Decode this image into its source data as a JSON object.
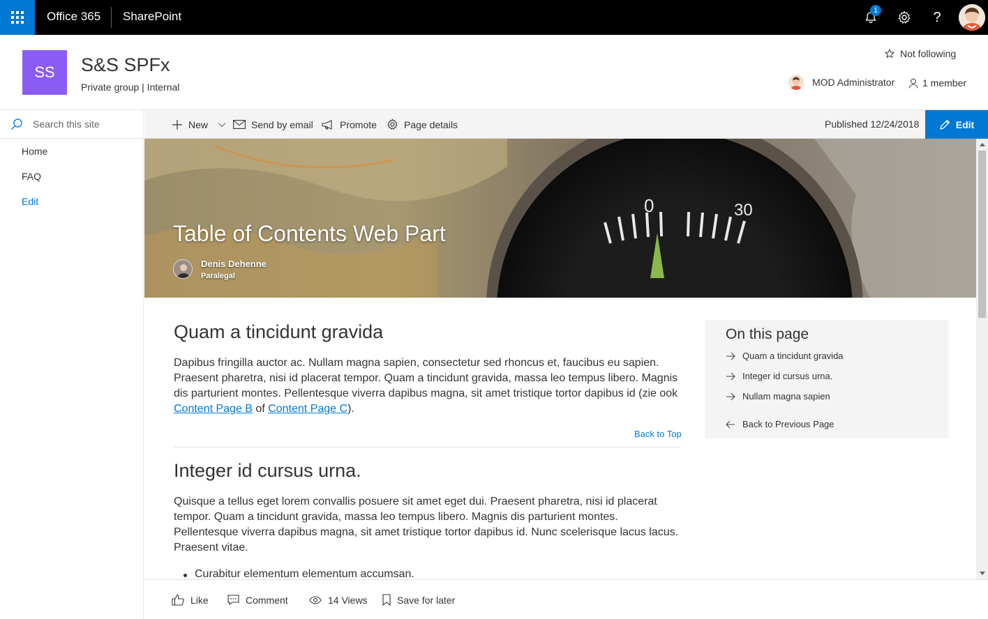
{
  "suite": {
    "app_name": "Office 365",
    "product": "SharePoint",
    "notification_count": "1",
    "help_label": "?"
  },
  "site": {
    "logo_initials": "SS",
    "title": "S&S SPFx",
    "subtitle": "Private group | Internal",
    "follow_label": "Not following",
    "admin_name": "MOD Administrator",
    "member_count": "1 member",
    "logo_color": "#8a5cf5"
  },
  "nav": {
    "search_placeholder": "Search this site",
    "items": [
      {
        "label": "Home"
      },
      {
        "label": "FAQ"
      },
      {
        "label": "Edit"
      }
    ]
  },
  "command_bar": {
    "new_label": "New",
    "send_label": "Send by email",
    "promote_label": "Promote",
    "details_label": "Page details",
    "published": "Published 12/24/2018",
    "edit_label": "Edit"
  },
  "hero": {
    "title": "Table of Contents Web Part",
    "author_name": "Denis Dehenne",
    "author_role": "Paralegal"
  },
  "sections": [
    {
      "heading": "Quam a tincidunt gravida",
      "text_before": "Dapibus fringilla auctor ac. Nullam magna sapien, consectetur sed rhoncus et, faucibus eu sapien. Praesent pharetra, nisi id placerat tempor. Quam a tincidunt gravida, massa leo tempus libero. Magnis dis parturient montes. Pellentesque viverra dapibus magna, sit amet tristique tortor dapibus id (zie ook ",
      "link1": "Content Page B",
      "middle": " of ",
      "link2": "Content Page C",
      "text_after": ").",
      "back_to_top": "Back to Top"
    },
    {
      "heading": "Integer id cursus urna.",
      "text": "Quisque a tellus eget lorem convallis posuere sit amet eget dui. Praesent pharetra, nisi id placerat tempor. Quam a tincidunt gravida, massa leo tempus libero. Magnis dis parturient montes. Pellentesque viverra dapibus magna, sit amet tristique tortor dapibus id. Nunc scelerisque lacus lacus. Praesent vitae.",
      "bullet": "Curabitur elementum elementum accumsan."
    }
  ],
  "toc": {
    "title": "On this page",
    "items": [
      {
        "label": "Quam a tincidunt gravida"
      },
      {
        "label": "Integer id cursus urna."
      },
      {
        "label": "Nullam magna sapien"
      }
    ],
    "back_label": "Back to Previous Page"
  },
  "footer": {
    "like": "Like",
    "comment": "Comment",
    "views": "14 Views",
    "save": "Save for later"
  },
  "colors": {
    "accent": "#0078d4",
    "suite_bar": "#000000",
    "toc_bg": "#f4f4f4"
  }
}
